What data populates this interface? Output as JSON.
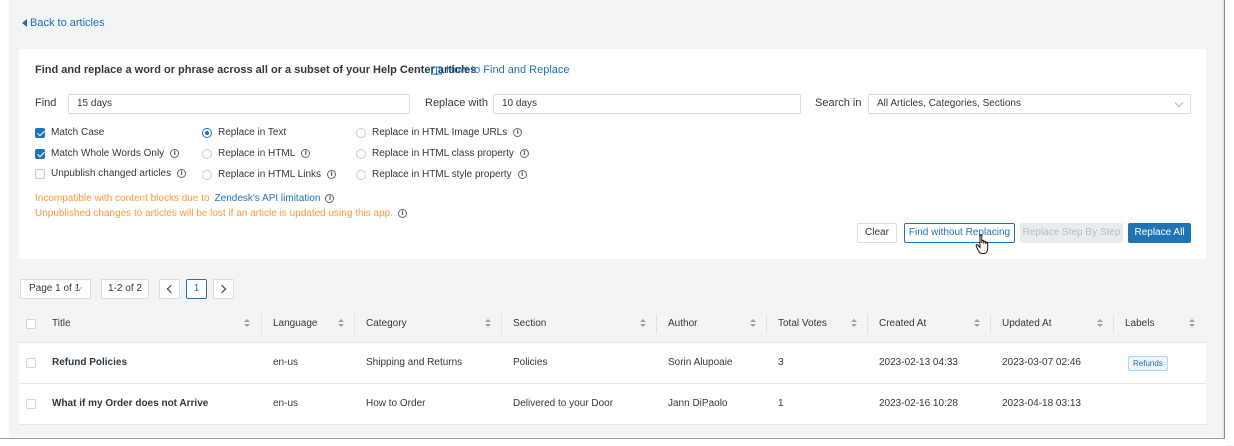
{
  "nav": {
    "back_label": "Back to articles"
  },
  "panel": {
    "title": "Find and replace a word or phrase across all or a subset of your Help Center articles",
    "howto_label": "How to Find and Replace",
    "find": {
      "label": "Find",
      "value": "15 days"
    },
    "replace": {
      "label": "Replace with",
      "value": "10 days"
    },
    "search_in": {
      "label": "Search in",
      "value": "All Articles, Categories, Sections"
    },
    "checkboxes": [
      {
        "label": "Match Case",
        "checked": true
      },
      {
        "label": "Match Whole Words Only",
        "checked": true
      },
      {
        "label": "Unpublish changed articles",
        "checked": false
      }
    ],
    "radios": [
      {
        "label": "Replace in Text",
        "selected": true
      },
      {
        "label": "Replace in HTML",
        "selected": false
      },
      {
        "label": "Replace in HTML Links",
        "selected": false
      },
      {
        "label": "Replace in HTML Image URLs",
        "selected": false
      },
      {
        "label": "Replace in HTML class property",
        "selected": false
      },
      {
        "label": "Replace in HTML style property",
        "selected": false
      }
    ],
    "warning1_prefix": "Incompatible with content blocks due to",
    "warning1_link": "Zendesk's API limitation",
    "warning2": "Unpublished changes to articles will be lost if an article is updated using this app.",
    "buttons": {
      "clear": "Clear",
      "find_without_replacing": "Find without Replacing",
      "replace_step": "Replace Step By Step",
      "replace_all": "Replace All"
    }
  },
  "pagination": {
    "page_select": "Page 1 of 1",
    "range": "1-2 of 2",
    "current_page": "1"
  },
  "table": {
    "columns": [
      "Title",
      "Language",
      "Category",
      "Section",
      "Author",
      "Total Votes",
      "Created At",
      "Updated At",
      "Labels"
    ],
    "rows": [
      {
        "title": "Refund Policies",
        "language": "en-us",
        "category": "Shipping and Returns",
        "section": "Policies",
        "author": "Sorin Alupoaie",
        "votes": "3",
        "created": "2023-02-13 04:33",
        "updated": "2023-03-07 02:46",
        "label": "Refunds"
      },
      {
        "title": "What if my Order does not Arrive",
        "language": "en-us",
        "category": "How to Order",
        "section": "Delivered to your Door",
        "author": "Jann DiPaolo",
        "votes": "1",
        "created": "2023-02-16 10:28",
        "updated": "2023-04-18 03:13",
        "label": ""
      }
    ]
  },
  "colors": {
    "accent": "#1f73b7",
    "warning": "#f79a3e",
    "background": "#f3f4f6"
  }
}
